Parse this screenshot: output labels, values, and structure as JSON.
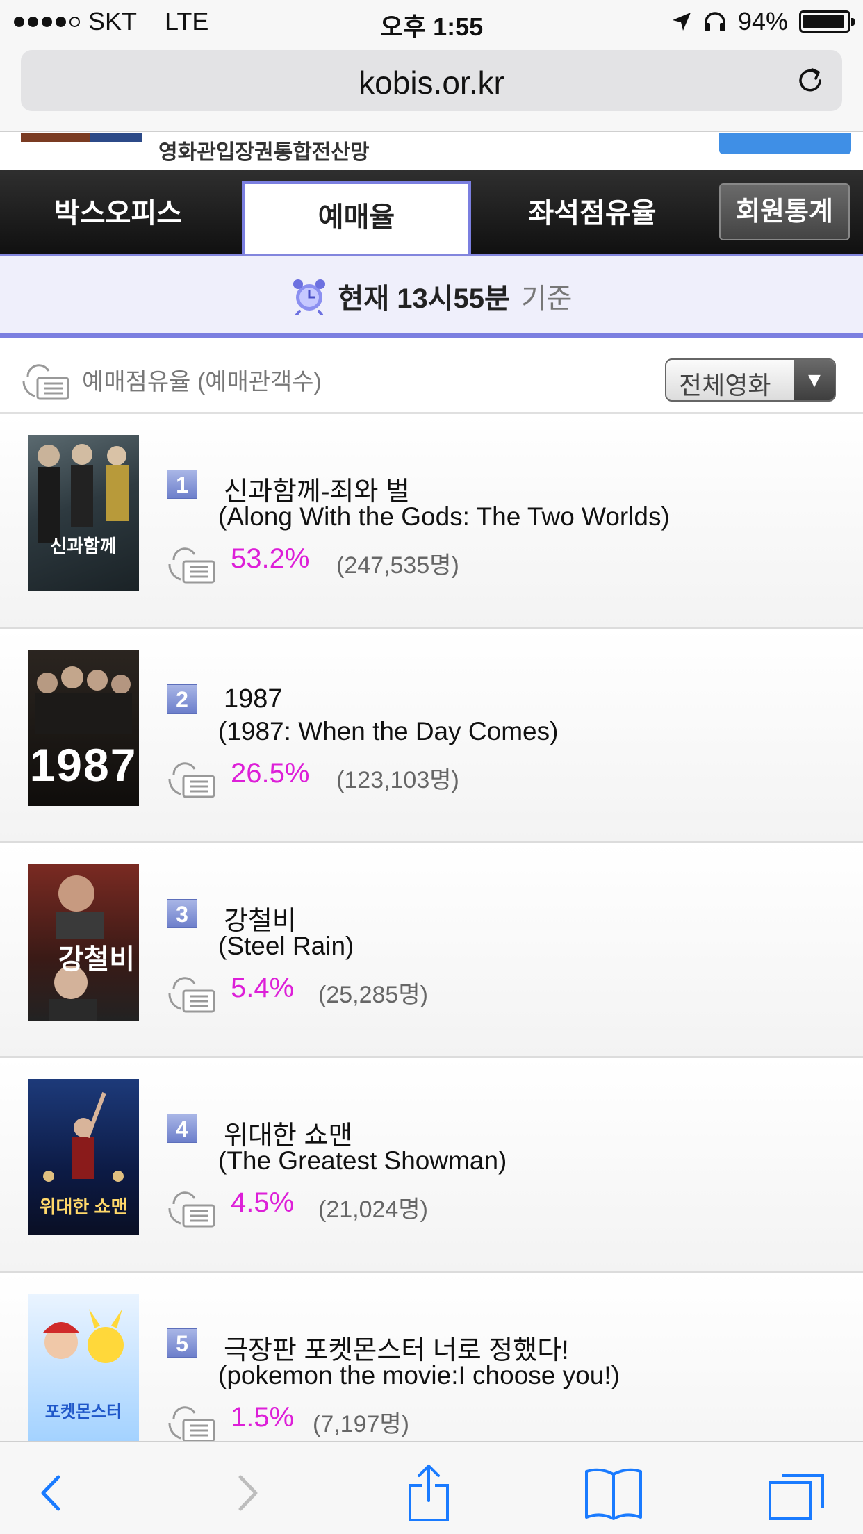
{
  "status": {
    "carrier": "SKT",
    "network": "LTE",
    "time": "오후 1:55",
    "battery": "94%",
    "battery_level": 0.94
  },
  "browser": {
    "url": "kobis.or.kr"
  },
  "banner": {
    "text": "영화관입장권통합전산망"
  },
  "tabs": [
    {
      "label": "박스오피스"
    },
    {
      "label": "예매율"
    },
    {
      "label": "좌석점유율"
    },
    {
      "label": "회원통계"
    }
  ],
  "timeband": {
    "now": "현재 13시55분",
    "base": "기준"
  },
  "section": {
    "label": "예매점유율 (예매관객수)",
    "filter": "전체영화"
  },
  "colors": {
    "accent": "#7b7fe0",
    "percent": "#dd1fd8"
  },
  "movies": [
    {
      "rank": "1",
      "title_ko": "신과함께-죄와 벌",
      "title_en": "(Along With the Gods: The Two Worlds)",
      "percent": "53.2%",
      "count": "(247,535명)",
      "poster_text": "신과함께"
    },
    {
      "rank": "2",
      "title_ko": "1987",
      "title_en": "(1987: When the Day Comes)",
      "percent": "26.5%",
      "count": "(123,103명)",
      "poster_text": "1987"
    },
    {
      "rank": "3",
      "title_ko": "강철비",
      "title_en": "(Steel Rain)",
      "percent": "5.4%",
      "count": "(25,285명)",
      "poster_text": "강철비"
    },
    {
      "rank": "4",
      "title_ko": "위대한 쇼맨",
      "title_en": "(The Greatest Showman)",
      "percent": "4.5%",
      "count": "(21,024명)",
      "poster_text": "위대한 쇼맨"
    },
    {
      "rank": "5",
      "title_ko": "극장판 포켓몬스터 너로 정했다!",
      "title_en": "(pokemon the movie:I choose you!)",
      "percent": "1.5%",
      "count": "(7,197명)",
      "poster_text": "포켓몬스터"
    }
  ],
  "toolbar": {
    "icons": [
      "back-icon",
      "forward-icon",
      "share-icon",
      "bookmarks-icon",
      "tabs-icon"
    ]
  }
}
